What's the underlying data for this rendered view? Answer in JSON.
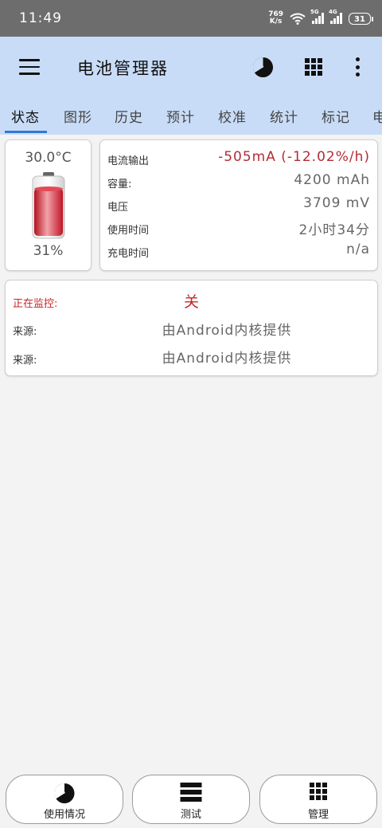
{
  "status_bar": {
    "time": "11:49",
    "net_speed_value": "769",
    "net_speed_unit": "K/s",
    "signal1_label": "5G",
    "signal2_label": "4G",
    "battery_level": "31"
  },
  "app_bar": {
    "title": "电池管理器",
    "icons": [
      "menu-icon",
      "pie-chart-icon",
      "grid-icon",
      "more-icon"
    ]
  },
  "tabs": [
    {
      "label": "状态",
      "active": true
    },
    {
      "label": "图形"
    },
    {
      "label": "历史"
    },
    {
      "label": "预计"
    },
    {
      "label": "校准"
    },
    {
      "label": "统计"
    },
    {
      "label": "标记"
    },
    {
      "label": "电"
    }
  ],
  "battery_card": {
    "temperature": "30.0°C",
    "percent": "31%",
    "level_fraction": 0.31
  },
  "stats": [
    {
      "key": "电流输出",
      "value": "-505mA (-12.02%/h)"
    },
    {
      "key": "容量:",
      "value": "4200 mAh"
    },
    {
      "key": "电压",
      "value": "3709 mV"
    },
    {
      "key": "使用时间",
      "value": "2小时34分"
    },
    {
      "key": "充电时间",
      "value": "n/a"
    }
  ],
  "monitor": {
    "monitoring_label": "正在监控:",
    "monitoring_value": "关",
    "source1_label": "来源:",
    "source1_value": "由Android内核提供",
    "source2_label": "来源:",
    "source2_value": "由Android内核提供"
  },
  "bottom_nav": [
    {
      "label": "使用情况",
      "icon": "pie-chart-icon"
    },
    {
      "label": "测试",
      "icon": "list-icon"
    },
    {
      "label": "管理",
      "icon": "grid-icon"
    }
  ],
  "colors": {
    "app_bar": "#c9dcf7",
    "accent": "#2f79d6",
    "alert": "#c62828",
    "current_value": "#b52b36"
  }
}
